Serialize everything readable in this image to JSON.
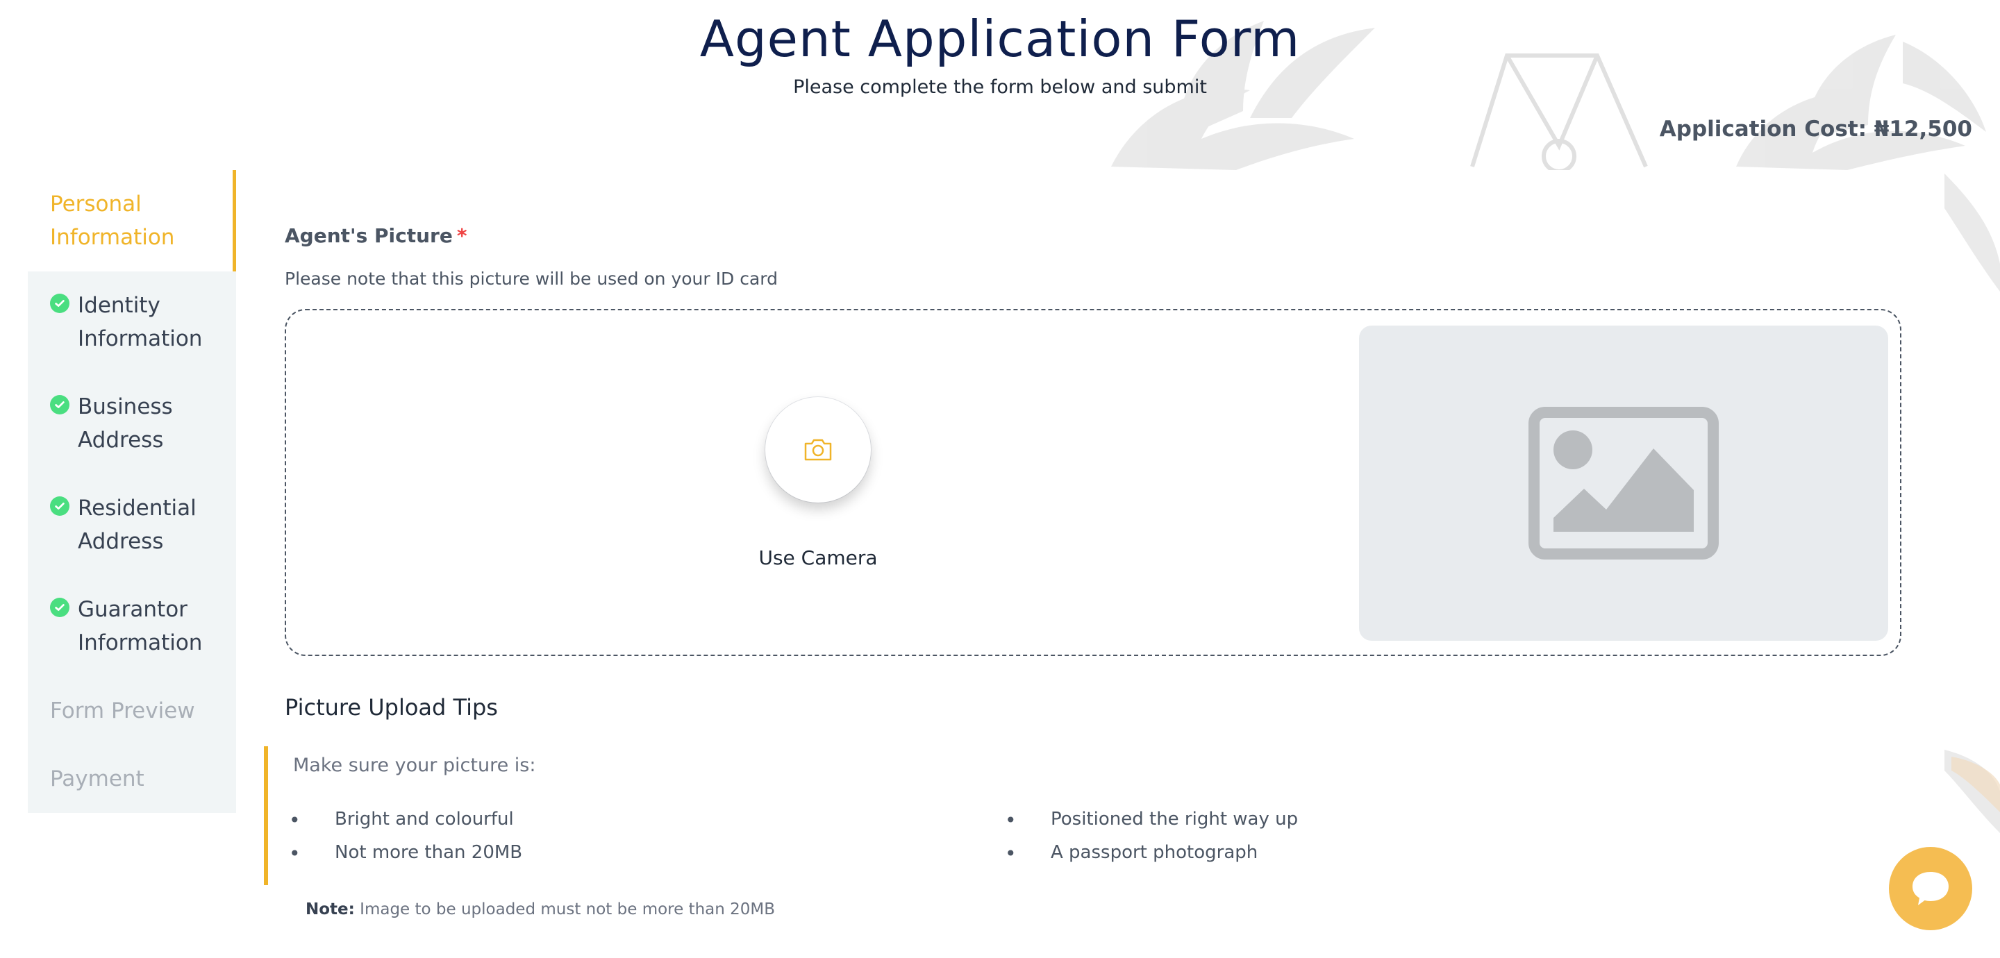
{
  "header": {
    "title": "Agent Application Form",
    "subtitle": "Please complete the form below and submit",
    "cost": "Application Cost: ₦12,500"
  },
  "sidebar": {
    "items": [
      {
        "label": "Personal Information",
        "state": "active"
      },
      {
        "label": "Identity Information",
        "state": "done"
      },
      {
        "label": "Business Address",
        "state": "done"
      },
      {
        "label": "Residential Address",
        "state": "done"
      },
      {
        "label": "Guarantor Information",
        "state": "done"
      },
      {
        "label": "Form Preview",
        "state": "disabled"
      },
      {
        "label": "Payment",
        "state": "disabled"
      }
    ]
  },
  "picture": {
    "label": "Agent's Picture",
    "required_mark": "*",
    "hint": "Please note that this picture will be used on your ID card",
    "camera_label": "Use Camera"
  },
  "tips": {
    "title": "Picture Upload Tips",
    "lead": "Make sure your picture is:",
    "items": [
      "Bright and colourful",
      "Not more than 20MB",
      "Positioned the right way up",
      "A passport photograph"
    ]
  },
  "note": {
    "label": "Note:",
    "text": "Image to be uploaded must not be more than 20MB"
  },
  "colors": {
    "accent": "#f0b429",
    "success": "#4ade80",
    "title": "#0f1f4d",
    "chat": "#f5bd52"
  },
  "icons": {
    "camera": "camera-icon",
    "image_placeholder": "image-placeholder-icon",
    "check": "check-circle-icon",
    "chat": "chat-bubble-icon"
  }
}
